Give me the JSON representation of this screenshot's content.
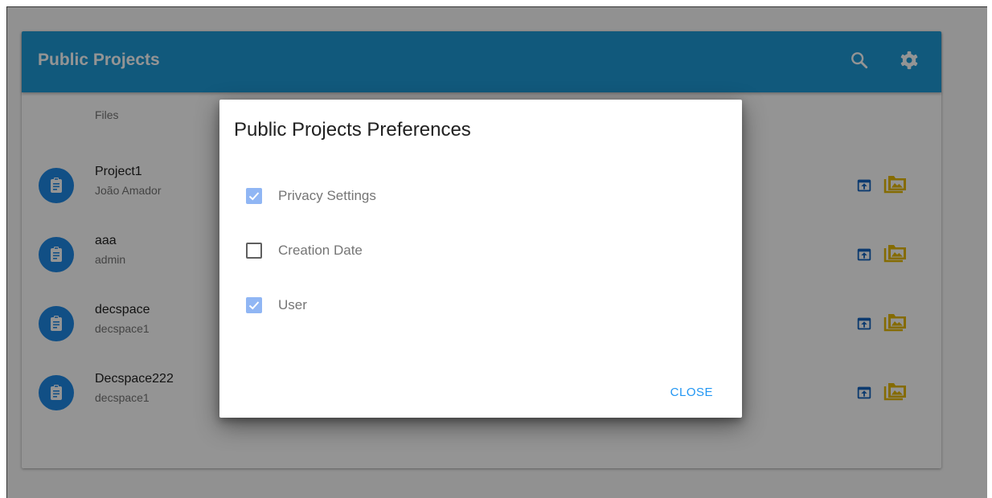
{
  "toolbar": {
    "title": "Public Projects",
    "icons": [
      "search-icon",
      "gear-icon"
    ],
    "color": "#1e9ad6"
  },
  "list": {
    "subheader": "Files",
    "items": [
      {
        "name": "Project1",
        "user": "João Amador"
      },
      {
        "name": "aaa",
        "user": "admin"
      },
      {
        "name": "decspace",
        "user": "decspace1"
      },
      {
        "name": "Decspace222",
        "user": "decspace1"
      }
    ],
    "item_icon": "clipboard-icon",
    "action_icons": [
      "open-in-browser-icon",
      "folder-images-icon"
    ]
  },
  "dialog": {
    "title": "Public Projects Preferences",
    "options": [
      {
        "label": "Privacy Settings",
        "checked": true
      },
      {
        "label": "Creation Date",
        "checked": false
      },
      {
        "label": "User",
        "checked": true
      }
    ],
    "close_label": "CLOSE"
  },
  "colors": {
    "accent": "#2196f3",
    "avatar": "#1e88e5",
    "folder": "#e6b800",
    "checkbox_checked": "#90b6f4"
  }
}
